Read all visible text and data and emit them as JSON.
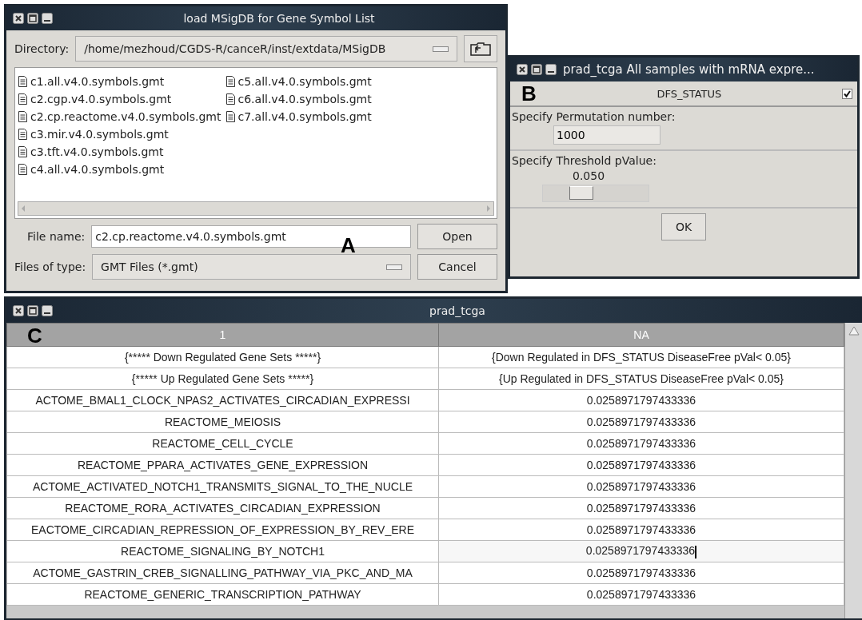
{
  "file_dialog": {
    "title": "load MSigDB for Gene Symbol List",
    "panel_label": "A",
    "directory_label": "Directory:",
    "directory": "/home/mezhoud/CGDS-R/canceR/inst/extdata/MSigDB",
    "files": [
      "c1.all.v4.0.symbols.gmt",
      "c2.cgp.v4.0.symbols.gmt",
      "c2.cp.reactome.v4.0.symbols.gmt",
      "c3.mir.v4.0.symbols.gmt",
      "c3.tft.v4.0.symbols.gmt",
      "c4.all.v4.0.symbols.gmt",
      "c5.all.v4.0.symbols.gmt",
      "c6.all.v4.0.symbols.gmt",
      "c7.all.v4.0.symbols.gmt"
    ],
    "file_name_label": "File name:",
    "file_name": "c2.cp.reactome.v4.0.symbols.gmt",
    "file_type_label": "Files of type:",
    "file_type": "GMT Files (*.gmt)",
    "buttons": [
      "Open",
      "Cancel"
    ]
  },
  "options_dialog": {
    "title": "prad_tcga All samples with mRNA expre...",
    "panel_label": "B",
    "header": "DFS_STATUS",
    "checked": true,
    "permutation_label": "Specify Permutation number:",
    "permutation": "1000",
    "threshold_label": "Specify Threshold pValue:",
    "threshold": "0.050",
    "level": 0.32,
    "button": "OK"
  },
  "results_window": {
    "title": "prad_tcga",
    "panel_label": "C",
    "columns": [
      "1",
      "NA"
    ],
    "rows": [
      {
        "cells": [
          "{***** Down Regulated Gene Sets *****}",
          "{Down Regulated in DFS_STATUS DiseaseFree pVal< 0.05}"
        ],
        "editing": false
      },
      {
        "cells": [
          "{***** Up Regulated Gene Sets *****}",
          "{Up Regulated in DFS_STATUS DiseaseFree pVal< 0.05}"
        ],
        "editing": false
      },
      {
        "cells": [
          "ACTOME_BMAL1_CLOCK_NPAS2_ACTIVATES_CIRCADIAN_EXPRESSI",
          "0.0258971797433336"
        ],
        "editing": false
      },
      {
        "cells": [
          "REACTOME_MEIOSIS",
          "0.0258971797433336"
        ],
        "editing": false
      },
      {
        "cells": [
          "REACTOME_CELL_CYCLE",
          "0.0258971797433336"
        ],
        "editing": false
      },
      {
        "cells": [
          "REACTOME_PPARA_ACTIVATES_GENE_EXPRESSION",
          "0.0258971797433336"
        ],
        "editing": false
      },
      {
        "cells": [
          "ACTOME_ACTIVATED_NOTCH1_TRANSMITS_SIGNAL_TO_THE_NUCLE",
          "0.0258971797433336"
        ],
        "editing": false
      },
      {
        "cells": [
          "REACTOME_RORA_ACTIVATES_CIRCADIAN_EXPRESSION",
          "0.0258971797433336"
        ],
        "editing": false
      },
      {
        "cells": [
          "EACTOME_CIRCADIAN_REPRESSION_OF_EXPRESSION_BY_REV_ERE",
          "0.0258971797433336"
        ],
        "editing": false
      },
      {
        "cells": [
          "REACTOME_SIGNALING_BY_NOTCH1",
          "0.0258971797433336"
        ],
        "editing": true
      },
      {
        "cells": [
          "ACTOME_GASTRIN_CREB_SIGNALLING_PATHWAY_VIA_PKC_AND_MA",
          "0.0258971797433336"
        ],
        "editing": false
      },
      {
        "cells": [
          "REACTOME_GENERIC_TRANSCRIPTION_PATHWAY",
          "0.0258971797433336"
        ],
        "editing": false
      }
    ]
  }
}
